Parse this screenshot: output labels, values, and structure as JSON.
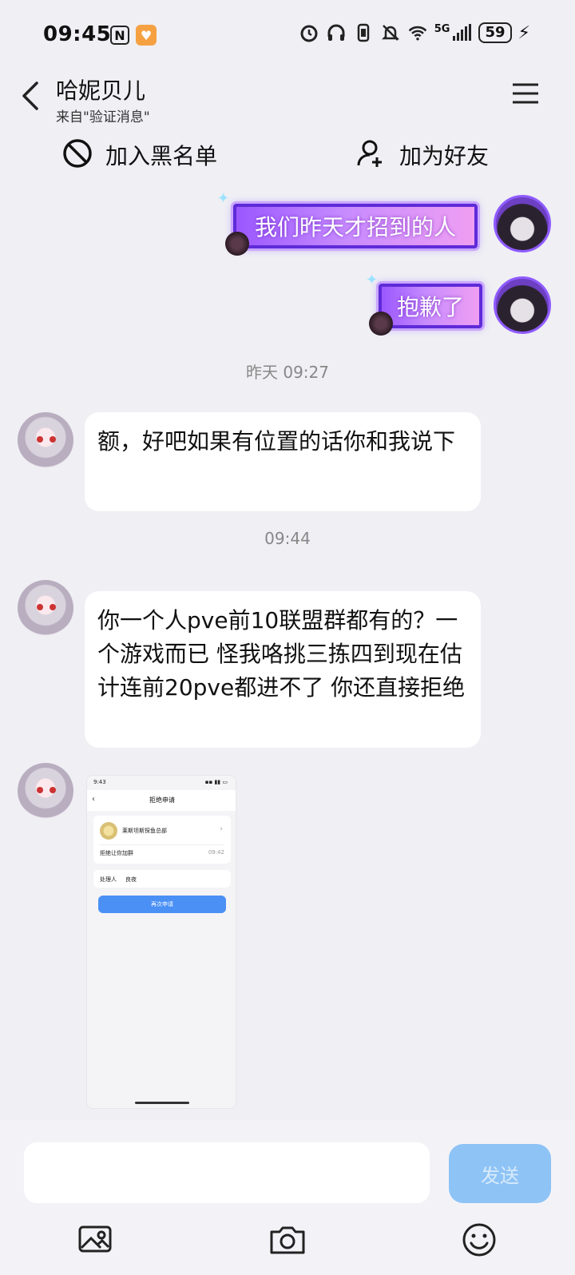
{
  "status_bar": {
    "time": "09:45",
    "nfc_glyph": "N",
    "network": "5G",
    "battery": "59",
    "icons": [
      "nfc-icon",
      "app-badge-icon",
      "alarm-icon",
      "headphones-icon",
      "vibrate-icon",
      "mute-icon",
      "wifi-icon",
      "signal-icon",
      "battery-icon",
      "charging-icon"
    ]
  },
  "header": {
    "title": "哈妮贝儿",
    "subtitle": "来自\"验证消息\""
  },
  "actions": {
    "blacklist": "加入黑名单",
    "add_friend": "加为好友"
  },
  "messages": {
    "out_1": "我们昨天才招到的人",
    "out_2": "抱歉了",
    "timestamp_1": "昨天 09:27",
    "in_1": "额，好吧如果有位置的话你和我说下",
    "timestamp_2": "09:44",
    "in_2": "你一个人pve前10联盟群都有的？一个游戏而已 怪我咯挑三拣四到现在估计连前20pve都进不了 你还直接拒绝"
  },
  "image_message": {
    "status_time": "9:43",
    "title": "拒绝申请",
    "group_name": "莱斯坦斯探鱼总部",
    "reject_text": "拒绝让你加群",
    "reject_time": "09:42",
    "handler_label": "处理人",
    "handler_name": "良夜",
    "button_label": "再次申请"
  },
  "input": {
    "placeholder": "",
    "send_label": "发送"
  },
  "colors": {
    "send_button": "#8ec3f6",
    "background": "#efeff4",
    "sticker_bubble": "#9b57ff"
  }
}
